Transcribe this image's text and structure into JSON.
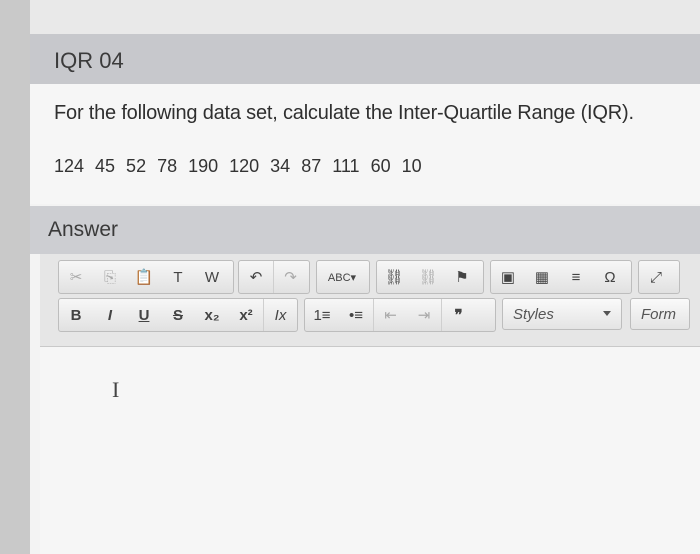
{
  "question": {
    "title": "IQR 04",
    "prompt": "For the following data set, calculate the Inter-Quartile Range (IQR).",
    "data_values": "124  45  52  78  190  120  34  87  111  60  10"
  },
  "answer": {
    "title": "Answer",
    "styles_label": "Styles",
    "format_label": "Form",
    "text_cursor_glyph": "I"
  },
  "toolbar": {
    "row1": [
      {
        "name": "cut-icon",
        "glyph": "✂",
        "dim": true
      },
      {
        "name": "copy-icon",
        "glyph": "⎘",
        "dim": true
      },
      {
        "name": "paste-icon",
        "glyph": "📋",
        "dim": false
      },
      {
        "name": "paste-text-icon",
        "glyph": "T",
        "dim": false
      },
      {
        "name": "paste-word-icon",
        "glyph": "W",
        "dim": false
      },
      {
        "name": "undo-icon",
        "glyph": "↶",
        "dim": false
      },
      {
        "name": "redo-icon",
        "glyph": "↷",
        "dim": true
      },
      {
        "name": "spellcheck-icon",
        "glyph": "ABC▾",
        "dim": false
      },
      {
        "name": "link-icon",
        "glyph": "⛓",
        "dim": false
      },
      {
        "name": "unlink-icon",
        "glyph": "⛓",
        "dim": true
      },
      {
        "name": "anchor-flag-icon",
        "glyph": "⚑",
        "dim": false
      },
      {
        "name": "image-icon",
        "glyph": "▣",
        "dim": false
      },
      {
        "name": "table-icon",
        "glyph": "▦",
        "dim": false
      },
      {
        "name": "horizontal-line-icon",
        "glyph": "≡",
        "dim": false
      },
      {
        "name": "special-char-icon",
        "glyph": "Ω",
        "dim": false
      },
      {
        "name": "maximize-icon",
        "glyph": "⤢",
        "dim": false
      }
    ],
    "row2": [
      {
        "name": "bold-button",
        "glyph": "B",
        "cls": "bold"
      },
      {
        "name": "italic-button",
        "glyph": "I",
        "cls": "italic bold"
      },
      {
        "name": "underline-button",
        "glyph": "U",
        "cls": "under bold"
      },
      {
        "name": "strikethrough-button",
        "glyph": "S",
        "cls": "strike bold"
      },
      {
        "name": "subscript-button",
        "glyph": "x₂",
        "cls": "bold"
      },
      {
        "name": "superscript-button",
        "glyph": "x²",
        "cls": "bold"
      },
      {
        "name": "remove-format-button",
        "glyph": "Ix",
        "cls": "italic"
      },
      {
        "name": "numbered-list-icon",
        "glyph": "1≡",
        "cls": ""
      },
      {
        "name": "bulleted-list-icon",
        "glyph": "•≡",
        "cls": ""
      },
      {
        "name": "outdent-icon",
        "glyph": "⇤",
        "cls": "dim"
      },
      {
        "name": "indent-icon",
        "glyph": "⇥",
        "cls": "dim"
      },
      {
        "name": "blockquote-icon",
        "glyph": "❞",
        "cls": "bold"
      }
    ]
  }
}
